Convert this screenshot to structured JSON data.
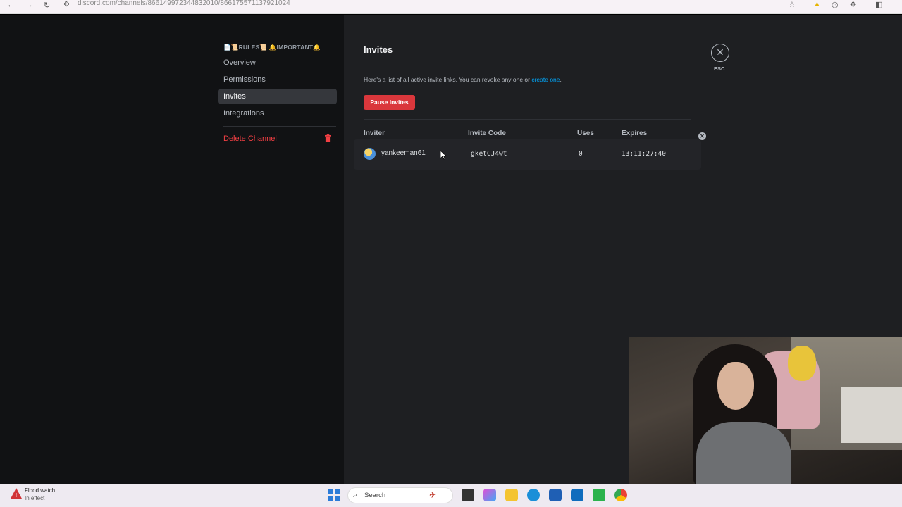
{
  "browser": {
    "url": "discord.com/channels/866149972344832010/866175571137921024",
    "back_icon": "←",
    "forward_icon": "→",
    "reload_icon": "↻"
  },
  "sidebar": {
    "channel_name": "📄📜RULES📜 🔔IMPORTANT🔔",
    "items": [
      {
        "label": "Overview"
      },
      {
        "label": "Permissions"
      },
      {
        "label": "Invites"
      },
      {
        "label": "Integrations"
      }
    ],
    "delete_label": "Delete Channel"
  },
  "main": {
    "title": "Invites",
    "description": "Here's a list of all active invite links. You can revoke any one or ",
    "create_link": "create one",
    "description_end": ".",
    "pause_button": "Pause Invites",
    "columns": {
      "inviter": "Inviter",
      "code": "Invite Code",
      "uses": "Uses",
      "expires": "Expires"
    },
    "rows": [
      {
        "inviter": "yankeeman61",
        "code": "gketCJ4wt",
        "uses": "0",
        "expires": "13:11:27:40"
      }
    ],
    "close_label": "ESC"
  },
  "taskbar": {
    "weather_title": "Flood watch",
    "weather_sub": "In effect",
    "search_label": "Search"
  },
  "colors": {
    "danger": "#da373c",
    "link": "#00a8fc",
    "background": "#1e1f22",
    "sidebar": "#111214"
  }
}
